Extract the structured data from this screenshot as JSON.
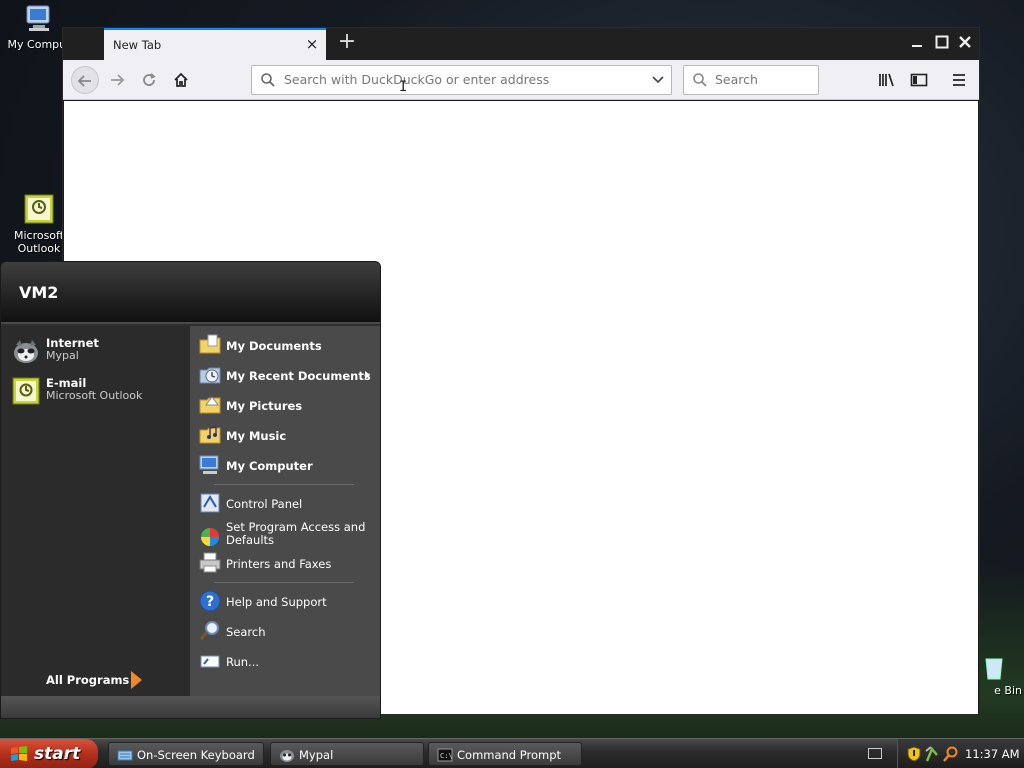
{
  "desktop": {
    "icons": [
      {
        "label": "My Comput"
      },
      {
        "label": "Microsoft\nOutlook"
      },
      {
        "label": "e Bin"
      }
    ]
  },
  "browser": {
    "tab_title": "New Tab",
    "tab_close": "×",
    "new_tab": "+",
    "url_placeholder": "Search with DuckDuckGo or enter address",
    "search_placeholder": "Search",
    "accent": "#0a84ff"
  },
  "start_menu": {
    "user": "VM2",
    "pinned": [
      {
        "title": "Internet",
        "subtitle": "Mypal"
      },
      {
        "title": "E-mail",
        "subtitle": "Microsoft Outlook"
      }
    ],
    "all_programs": "All Programs",
    "right_items": [
      {
        "label": "My Documents"
      },
      {
        "label": "My Recent Documents"
      },
      {
        "label": "My Pictures"
      },
      {
        "label": "My Music"
      },
      {
        "label": "My Computer"
      },
      {
        "label": "Control Panel"
      },
      {
        "label": "Set Program Access and\nDefaults"
      },
      {
        "label": "Printers and Faxes"
      },
      {
        "label": "Help and Support"
      },
      {
        "label": "Search"
      },
      {
        "label": "Run..."
      }
    ]
  },
  "taskbar": {
    "start_label": "start",
    "tasks": [
      {
        "label": "On-Screen Keyboard"
      },
      {
        "label": "Mypal"
      },
      {
        "label": "Command Prompt"
      }
    ],
    "clock": "11:37 AM"
  }
}
